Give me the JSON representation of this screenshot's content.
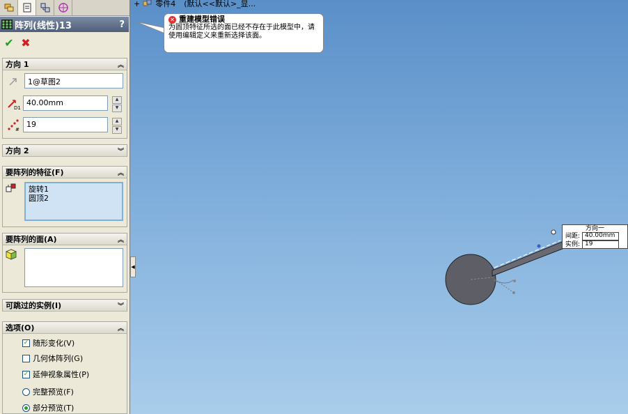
{
  "panel": {
    "tabs": [
      "feature-manager-icon",
      "property-manager-icon",
      "configuration-manager-icon",
      "dimxpert-icon"
    ],
    "title": "阵列(线性)13",
    "help": "?",
    "ok": "✔",
    "cancel": "✖",
    "direction1": {
      "header": "方向 1",
      "direction_ref": "1@草图2",
      "spacing": "40.00mm",
      "instances": "19"
    },
    "direction2": {
      "header": "方向 2"
    },
    "features_to_pattern": {
      "header": "要阵列的特征(F)",
      "items": [
        "旋转1",
        "圆顶2"
      ]
    },
    "faces_to_pattern": {
      "header": "要阵列的面(A)"
    },
    "instances_to_skip": {
      "header": "可跳过的实例(I)"
    },
    "options": {
      "header": "选项(O)",
      "vary_sketch": {
        "label": "随形变化(V)",
        "checked": true
      },
      "geometry_pattern": {
        "label": "几何体阵列(G)",
        "checked": false
      },
      "propagate_visual": {
        "label": "延伸视象属性(P)",
        "checked": true
      },
      "full_preview": {
        "label": "完整预览(F)",
        "selected": false
      },
      "partial_preview": {
        "label": "部分预览(T)",
        "selected": true
      }
    }
  },
  "tree": {
    "expand": "+",
    "part": "零件4",
    "config": "(默认<<默认>_显..."
  },
  "tooltip": {
    "title": "重建模型错误",
    "body": "为圆顶特征所选的面已经不存在于此模型中，请使用编辑定义来重新选择该面。"
  },
  "callout": {
    "title": "方向一",
    "spacing_label": "间距:",
    "spacing_value": "40.00mm",
    "instances_label": "实例:",
    "instances_value": "19"
  },
  "colors": {
    "viewport_top": "#5a8fc8",
    "viewport_bottom": "#a9cdeb",
    "title_bar": "#4f5f79",
    "ok": "#21a121",
    "cancel": "#d11e1e"
  }
}
